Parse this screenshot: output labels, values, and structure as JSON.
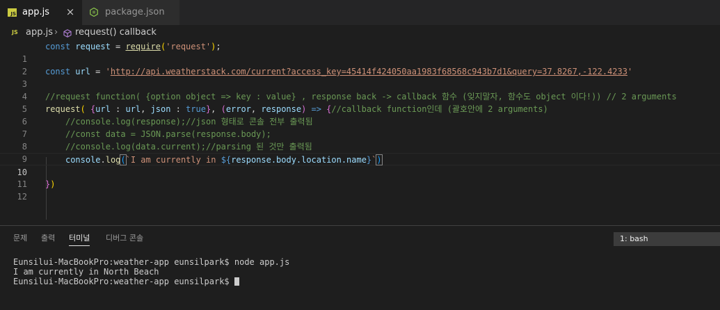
{
  "tabs": [
    {
      "label": "app.js",
      "badge": "JS",
      "active": true,
      "close": "×"
    },
    {
      "label": "package.json",
      "active": false
    }
  ],
  "breadcrumb": {
    "badge": "JS",
    "file": "app.js",
    "separator": "›",
    "symbol": "request() callback"
  },
  "editor": {
    "line_numbers": [
      "1",
      "2",
      "3",
      "4",
      "5",
      "6",
      "7",
      "8",
      "9",
      "10",
      "11",
      "12"
    ],
    "current_line": "10",
    "lines": {
      "l1": {
        "kw": "const",
        "var": "request",
        "eq": " = ",
        "fn": "require",
        "open": "(",
        "str": "'request'",
        "close": ")",
        "semi": ";"
      },
      "l3": {
        "kw": "const",
        "var": "url",
        "eq": " = ",
        "q1": "'",
        "url": "http://api.weatherstack.com/current?access_key=45414f424050aa1983f68568c943b7d1&query=37.8267,-122.4233",
        "q2": "'"
      },
      "l5": {
        "comment": "//request function( {option object => key : value} , response back -> callback 함수 (잊지말자, 함수도 object 이다!)) // 2 arguments"
      },
      "l6": {
        "fn": "request",
        "open": "(",
        "sp1": " ",
        "brace": "{",
        "k1": "url",
        "c1": " : ",
        "v1": "url",
        "comma1": ", ",
        "k2": "json",
        "c2": " : ",
        "v2": "true",
        "brace_close": "}",
        "comma2": ", ",
        "popen": "(",
        "p1": "error",
        "comma3": ", ",
        "p2": "response",
        "pclose": ")",
        "arrow": " => ",
        "body_open": "{",
        "comment": "//callback function인데 (괄호안에 2 arguments)"
      },
      "l7": {
        "comment": "//console.log(response);//json 형태로 콘솔 전부 출력됨"
      },
      "l8": {
        "comment": "//const data = JSON.parse(response.body);"
      },
      "l9": {
        "comment": "//console.log(data.current);//parsing 된 것만 출력됨"
      },
      "l10": {
        "obj": "console",
        "dot": ".",
        "fn": "log",
        "open": "(",
        "tpl_start": "`I am currently in ",
        "interp_open": "${",
        "expr": "response.body.location.name",
        "interp_close": "}",
        "tpl_end": "`",
        "close": ")"
      },
      "l12": {
        "body_close": "}",
        "close": ")"
      }
    }
  },
  "panel": {
    "tabs": [
      "문제",
      "출력",
      "터미널",
      "디버그 콘솔"
    ],
    "active_tab": "터미널",
    "terminal_select": "1: bash",
    "terminal_lines": [
      "Eunsilui-MacBookPro:weather-app eunsilpark$ node app.js",
      "I am currently in North Beach",
      "Eunsilui-MacBookPro:weather-app eunsilpark$ "
    ]
  }
}
